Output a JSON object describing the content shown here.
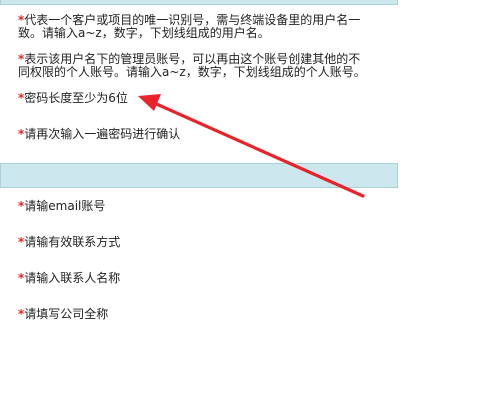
{
  "account_section": {
    "hints": [
      {
        "marker": "*",
        "text": "代表一个客户或项目的唯一识别号，需与终端设备里的用户名一\n致。请输入a~z，数字，下划线组成的用户名。"
      },
      {
        "marker": "*",
        "text": "表示该用户名下的管理员账号，可以再由这个账号创建其他的不\n同权限的个人账号。请输入a~z，数字，下划线组成的个人账号。"
      },
      {
        "marker": "*",
        "text": "密码长度至少为6位"
      },
      {
        "marker": "*",
        "text": "请再次输入一遍密码进行确认"
      }
    ]
  },
  "contact_section": {
    "hints": [
      {
        "marker": "*",
        "text": "请输email账号"
      },
      {
        "marker": "*",
        "text": "请输有效联系方式"
      },
      {
        "marker": "*",
        "text": "请输入联系人名称"
      },
      {
        "marker": "*",
        "text": "请填写公司全称"
      }
    ]
  },
  "colors": {
    "section_header": "#cce7ee",
    "required_marker": "#e3261f",
    "annotation_arrow": "#e8232a"
  }
}
